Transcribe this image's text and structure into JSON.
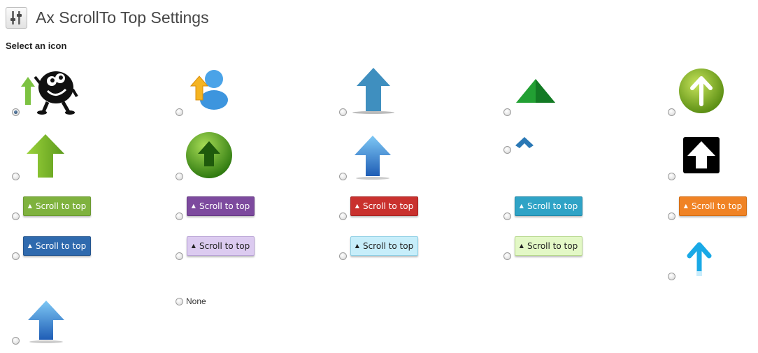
{
  "title": "Ax ScrollTo Top Settings",
  "section_label": "Select an icon",
  "button_label": "Scroll to top",
  "none_label": "None",
  "selected_option": 1,
  "colors": {
    "green_button": "#7fb23e",
    "purple_button": "#7d4a9e",
    "red_button": "#c9312e",
    "teal_button": "#2fa3c6",
    "orange_button": "#f08325",
    "blue_button": "#2f6aae",
    "lavender_button": "#dccbf0",
    "light_blue_button": "#c7eefa",
    "light_green_button": "#e3f8c6"
  }
}
